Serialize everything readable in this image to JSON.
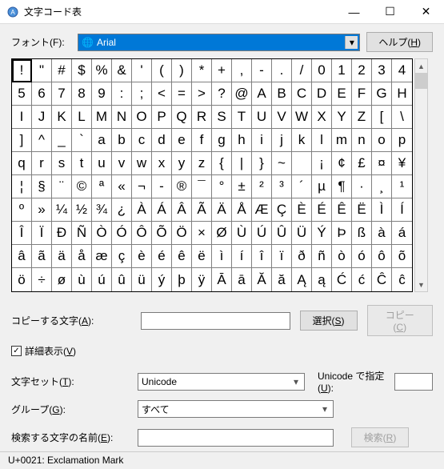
{
  "window": {
    "title": "文字コード表",
    "minimize": "—",
    "maximize": "☐",
    "close": "✕"
  },
  "fontRow": {
    "label": "フォント(F):",
    "selected": "Arial",
    "helpBtn": "ヘルプ(H)"
  },
  "grid": {
    "chars": [
      "!",
      "\"",
      "#",
      "$",
      "%",
      "&",
      "'",
      "(",
      ")",
      "*",
      "+",
      ",",
      "-",
      ".",
      "/",
      "0",
      "1",
      "2",
      "3",
      "4",
      "5",
      "6",
      "7",
      "8",
      "9",
      ":",
      ";",
      "<",
      "=",
      ">",
      "?",
      "@",
      "A",
      "B",
      "C",
      "D",
      "E",
      "F",
      "G",
      "H",
      "I",
      "J",
      "K",
      "L",
      "M",
      "N",
      "O",
      "P",
      "Q",
      "R",
      "S",
      "T",
      "U",
      "V",
      "W",
      "X",
      "Y",
      "Z",
      "[",
      "\\",
      "]",
      "^",
      "_",
      "`",
      "a",
      "b",
      "c",
      "d",
      "e",
      "f",
      "g",
      "h",
      "i",
      "j",
      "k",
      "l",
      "m",
      "n",
      "o",
      "p",
      "q",
      "r",
      "s",
      "t",
      "u",
      "v",
      "w",
      "x",
      "y",
      "z",
      "{",
      "|",
      "}",
      "~",
      "",
      "¡",
      "¢",
      "£",
      "¤",
      "¥",
      "¦",
      "§",
      "¨",
      "©",
      "ª",
      "«",
      "¬",
      "-",
      "®",
      "¯",
      "°",
      "±",
      "²",
      "³",
      "´",
      "µ",
      "¶",
      "·",
      "¸",
      "¹",
      "º",
      "»",
      "¼",
      "½",
      "¾",
      "¿",
      "À",
      "Á",
      "Â",
      "Ã",
      "Ä",
      "Å",
      "Æ",
      "Ç",
      "È",
      "É",
      "Ê",
      "Ë",
      "Ì",
      "Í",
      "Î",
      "Ï",
      "Ð",
      "Ñ",
      "Ò",
      "Ó",
      "Ô",
      "Õ",
      "Ö",
      "×",
      "Ø",
      "Ù",
      "Ú",
      "Û",
      "Ü",
      "Ý",
      "Þ",
      "ß",
      "à",
      "á",
      "â",
      "ã",
      "ä",
      "å",
      "æ",
      "ç",
      "è",
      "é",
      "ê",
      "ë",
      "ì",
      "í",
      "î",
      "ï",
      "ð",
      "ñ",
      "ò",
      "ó",
      "ô",
      "õ",
      "ö",
      "÷",
      "ø",
      "ù",
      "ú",
      "û",
      "ü",
      "ý",
      "þ",
      "ÿ",
      "Ā",
      "ā",
      "Ă",
      "ă",
      "Ą",
      "ą",
      "Ć",
      "ć",
      "Ĉ",
      "ĉ"
    ],
    "selectedIndex": 0,
    "scrollUp": "▲",
    "scrollDown": "▼"
  },
  "copyRow": {
    "label": "コピーする文字(A):",
    "value": "",
    "selectBtn": "選択(S)",
    "copyBtn": "コピー(C)"
  },
  "advancedCheck": {
    "checked": true,
    "label": "詳細表示(V)",
    "checkmark": "✓"
  },
  "charset": {
    "label": "文字セット(T):",
    "value": "Unicode",
    "gotoLabel": "Unicode で指定(U):",
    "gotoValue": ""
  },
  "group": {
    "label": "グループ(G):",
    "value": "すべて"
  },
  "search": {
    "label": "検索する文字の名前(E):",
    "value": "",
    "btn": "検索(R)"
  },
  "status": "U+0021: Exclamation Mark"
}
